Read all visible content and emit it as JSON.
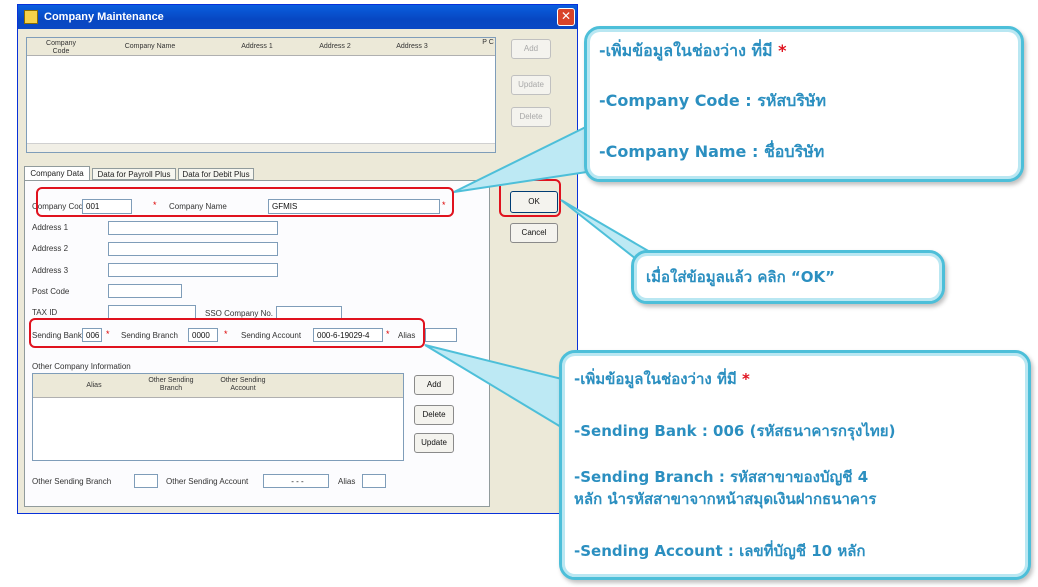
{
  "window": {
    "title": "Company Maintenance",
    "close_symbol": "✕"
  },
  "grid": {
    "headers": [
      "Company Code",
      "Company Name",
      "Address 1",
      "Address 2",
      "Address 3",
      "P C"
    ],
    "side_buttons": [
      "Add",
      "Update",
      "Delete"
    ]
  },
  "tabs": [
    "Company Data",
    "Data for Payroll Plus",
    "Data for Debit Plus"
  ],
  "form": {
    "company_code_label": "Company Code",
    "company_code_value": "001",
    "company_name_label": "Company Name",
    "company_name_value": "GFMIS",
    "address1_label": "Address 1",
    "address2_label": "Address 2",
    "address3_label": "Address 3",
    "postcode_label": "Post Code",
    "taxid_label": "TAX ID",
    "sso_label": "SSO Company No.",
    "sending_bank_label": "Sending Bank",
    "sending_bank_value": "006",
    "sending_branch_label": "Sending Branch",
    "sending_branch_value": "0000",
    "sending_account_label": "Sending Account",
    "sending_account_value": "000-6-19029-4",
    "alias_label": "Alias",
    "required_mark": "*"
  },
  "other_info": {
    "group_label": "Other Company Information",
    "headers": [
      "Alias",
      "Other Sending Branch",
      "Other Sending Account"
    ],
    "buttons": [
      "Add",
      "Delete",
      "Update"
    ],
    "bottom_branch_label": "Other Sending Branch",
    "bottom_account_label": "Other Sending Account",
    "bottom_account_value": "- - -",
    "bottom_alias_label": "Alias"
  },
  "dialog_buttons": {
    "ok": "OK",
    "cancel": "Cancel"
  },
  "callouts": {
    "top": {
      "line1": "-เพิ่มข้อมูลในช่องว่าง ที่มี",
      "star": "*",
      "line2": "-Company Code : รหัสบริษัท",
      "line3": "-Company Name : ชื่อบริษัท"
    },
    "middle": {
      "text": "เมื่อใส่ข้อมูลแล้ว   คลิก “OK”"
    },
    "bottom": {
      "line1": "-เพิ่มข้อมูลในช่องว่าง ที่มี",
      "star": "*",
      "line2": "-Sending Bank : 006 (รหัสธนาคารกรุงไทย)",
      "line3a": "-Sending Branch : รหัสสาขาของบัญชี 4",
      "line3b": "หลัก นำรหัสสาขาจากหน้าสมุดเงินฝากธนาคาร",
      "line4": "-Sending Account : เลขที่บัญชี 10 หลัก"
    }
  },
  "colors": {
    "callout_border": "#4dbfd9",
    "callout_text": "#2b8fc0",
    "highlight": "#e0121e"
  }
}
